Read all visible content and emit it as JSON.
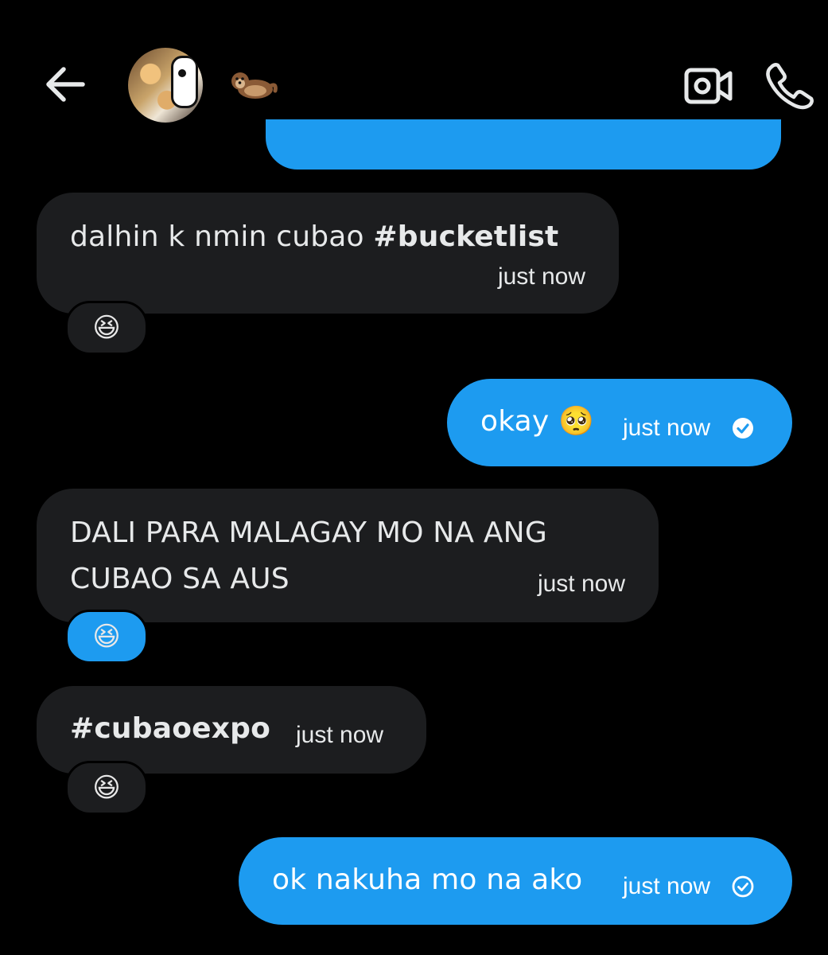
{
  "header": {
    "back_label": "Back",
    "avatar_name": "group avatar",
    "otter_emoji": "🦦",
    "video_icon": "video-camera-icon",
    "call_icon": "phone-icon"
  },
  "messages": [
    {
      "direction": "in",
      "text_plain": "dalhin k nmin cubao ",
      "text_bold": "#bucketlist",
      "time": "just now",
      "reaction": "😆"
    },
    {
      "direction": "out",
      "text": "okay 🥺",
      "time": "just now",
      "status": "seen"
    },
    {
      "direction": "in",
      "line1": "DALI PARA MALAGAY MO NA ANG",
      "line2": "CUBAO SA AUS",
      "time": "just now",
      "reaction": "😆"
    },
    {
      "direction": "in",
      "text_bold": "#cubaoexpo",
      "time": "just now",
      "reaction": "😆"
    },
    {
      "direction": "out",
      "text": "ok nakuha mo na ako",
      "time": "just now",
      "status": "sent"
    }
  ],
  "colors": {
    "background": "#000000",
    "incoming_bubble": "#1c1d1f",
    "outgoing_bubble": "#1d9bf0"
  }
}
